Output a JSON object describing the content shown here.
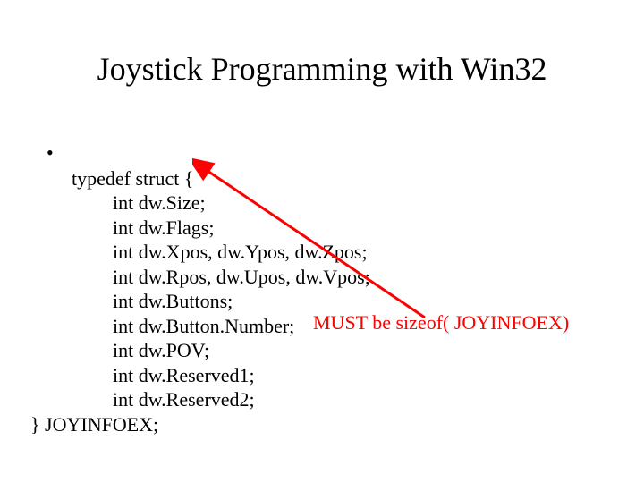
{
  "title": "Joystick Programming with Win32",
  "bullet": "•",
  "code": {
    "l0": "typedef struct {",
    "l1": "int dw.Size;",
    "l2": "int dw.Flags;",
    "l3": "int dw.Xpos, dw.Ypos, dw.Zpos;",
    "l4": "int dw.Rpos, dw.Upos, dw.Vpos;",
    "l5": "int dw.Buttons;",
    "l6": "int dw.Button.Number;",
    "l7": "int dw.POV;",
    "l8": "int dw.Reserved1;",
    "l9": "int dw.Reserved2;",
    "l10": "} JOYINFOEX;"
  },
  "note": "MUST be sizeof( JOYINFOEX)"
}
